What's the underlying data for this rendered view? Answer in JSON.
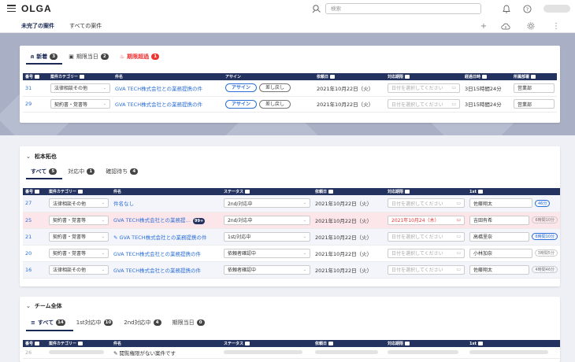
{
  "header": {
    "logo": "OLGA",
    "search_placeholder": "検索"
  },
  "subnav": {
    "tab_active": "未完了の案件",
    "tab_all": "すべての案件"
  },
  "card1": {
    "tabs": [
      {
        "label": "新着",
        "count": "3"
      },
      {
        "label": "期限当日",
        "count": "2"
      },
      {
        "label": "期限超過",
        "count": "1"
      }
    ],
    "columns": [
      "番号",
      "案件カテゴリー",
      "件名",
      "アサイン",
      "依頼日",
      "対応期限",
      "経過日時",
      "所属部署"
    ],
    "rows": [
      {
        "id": "31",
        "category": "法律相談その他",
        "title": "GVA TECH株式会社との業務提携の件",
        "assign": "アサイン",
        "back": "差し戻し",
        "date": "2021年10月22日（火）",
        "deadline": "日付を選択してください",
        "elapsed": "3日15時間24分",
        "dept": "営業部"
      },
      {
        "id": "29",
        "category": "契約書・覚書等",
        "title": "GVA TECH株式会社との業務提携の件",
        "assign": "アサイン",
        "back": "差し戻し",
        "date": "2021年10月22日（火）",
        "deadline": "日付を選択してください",
        "elapsed": "3日15時間24分",
        "dept": "営業部"
      }
    ]
  },
  "card2": {
    "title": "松本拓也",
    "tabs": [
      {
        "label": "すべて",
        "count": "5"
      },
      {
        "label": "対応中",
        "count": "1"
      },
      {
        "label": "確認待ち",
        "count": "4"
      }
    ],
    "columns": [
      "番号",
      "案件カテゴリー",
      "件名",
      "ステータス",
      "依頼日",
      "対応期限",
      "1st"
    ],
    "rows": [
      {
        "id": "27",
        "category": "法律相談その他",
        "title": "件名なし",
        "badge": "",
        "status": "2nd/対応中",
        "date": "2021年10月22日（火）",
        "deadline": "日付を選択してください",
        "person": "佐藤翔太",
        "pill": "46分"
      },
      {
        "id": "25",
        "category": "契約書・覚書等",
        "title": "GVA TECH株式会社との業務提…",
        "badge": "99+",
        "status": "2nd/対応中",
        "date": "2021年10月22日（火）",
        "deadline": "2021年10月24（木）",
        "person": "吉田有希",
        "pill": "6時間10分"
      },
      {
        "id": "21",
        "category": "契約書・覚書等",
        "title": "GVA TECH株式会社との業務提携の件",
        "badge": "",
        "status": "1st/対応中",
        "date": "2021年10月22日（火）",
        "deadline": "日付を選択してください",
        "person": "高橋里奈",
        "pill": "6時間10分"
      },
      {
        "id": "20",
        "category": "契約書・覚書等",
        "title": "GVA TECH株式会社との業務提携の件",
        "badge": "",
        "status": "依頼者確認中",
        "date": "2021年10月22日（火）",
        "deadline": "日付を選択してください",
        "person": "小林加奈",
        "pill": "3時間5分"
      },
      {
        "id": "16",
        "category": "法律相談その他",
        "title": "GVA TECH株式会社との業務提携の件",
        "badge": "",
        "status": "依頼者確認中",
        "date": "2021年10月22日（火）",
        "deadline": "日付を選択してください",
        "person": "佐藤翔太",
        "pill": "4時間46分"
      }
    ]
  },
  "card3": {
    "title": "チーム全体",
    "tabs": [
      {
        "label": "すべて",
        "count": "14"
      },
      {
        "label": "1st対応中",
        "count": "10"
      },
      {
        "label": "2nd対応中",
        "count": "4"
      },
      {
        "label": "期限当日",
        "count": "0"
      }
    ],
    "columns": [
      "番号",
      "案件カテゴリー",
      "件名",
      "ステータス",
      "依頼日",
      "対応期限",
      "1st"
    ],
    "row": {
      "id": "26",
      "title": "閲覧権限がない案件です"
    }
  }
}
